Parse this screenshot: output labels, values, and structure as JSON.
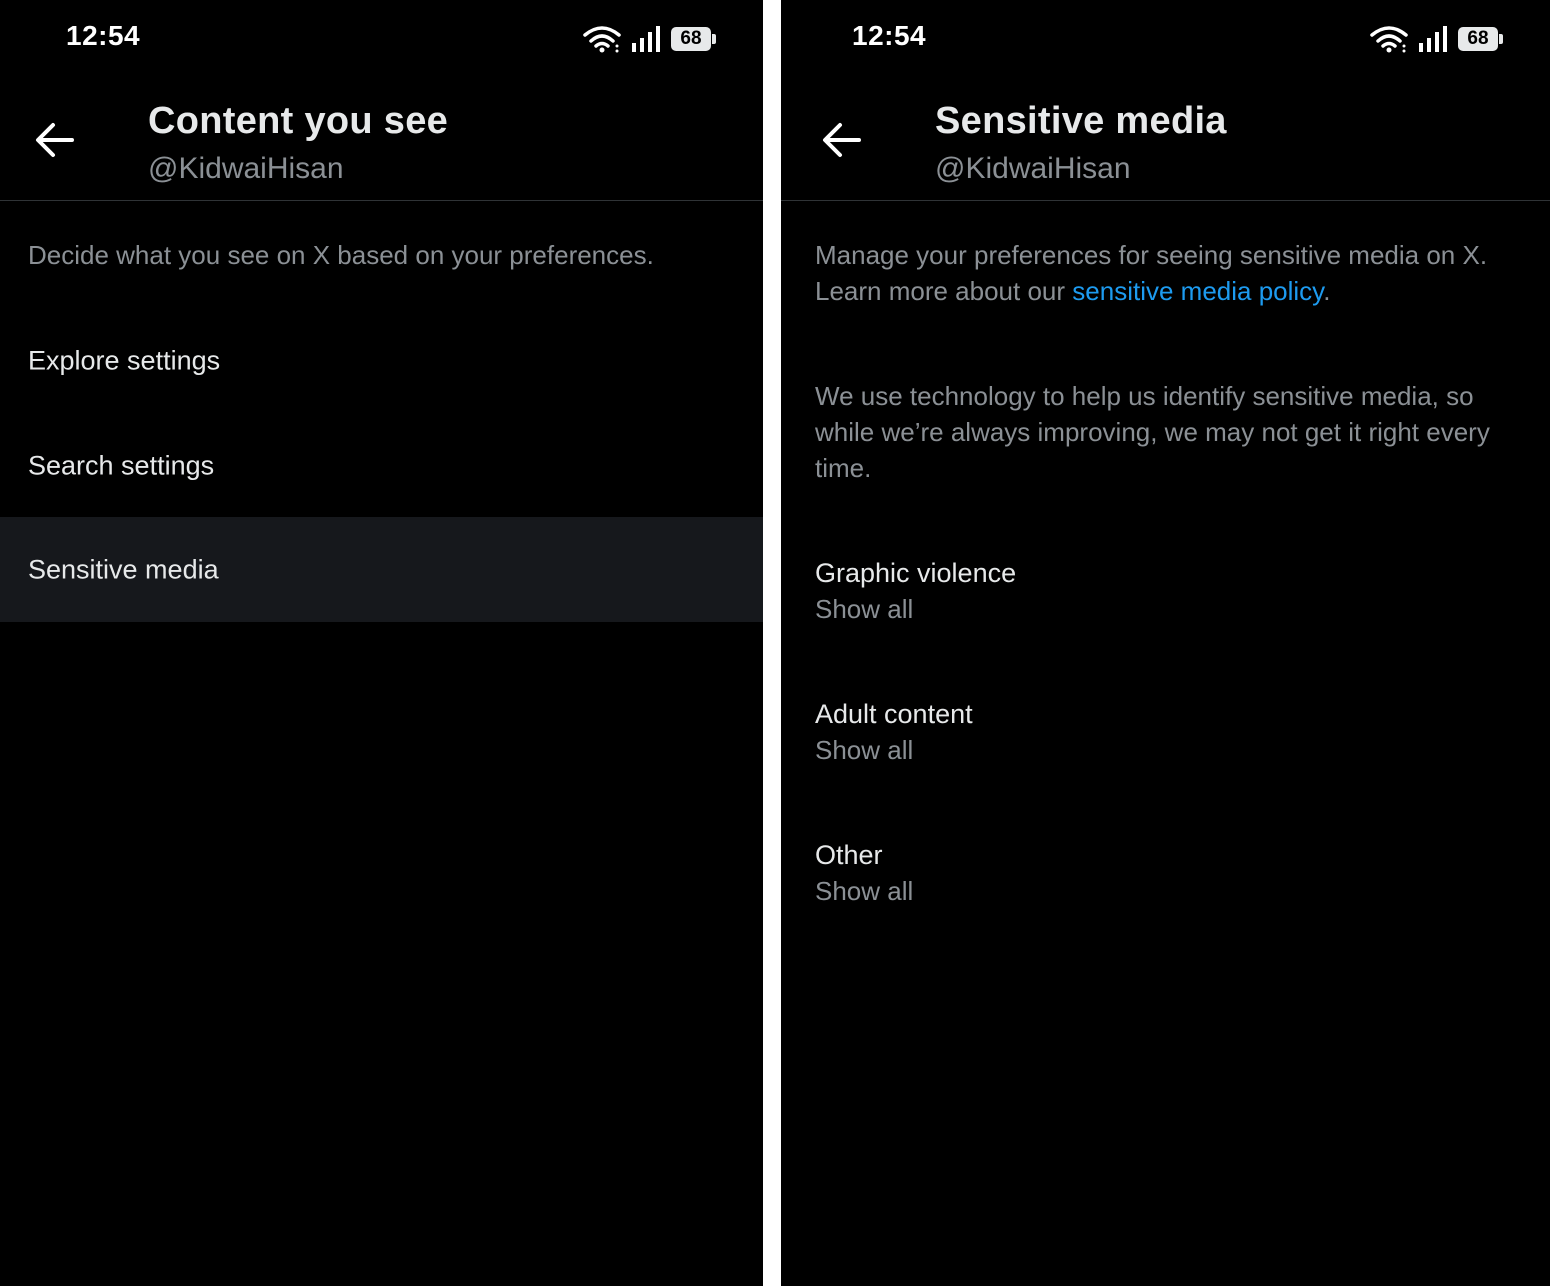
{
  "left_screen": {
    "status": {
      "time": "12:54",
      "battery": "68"
    },
    "header": {
      "title": "Content you see",
      "handle": "@KidwaiHisan"
    },
    "description": "Decide what you see on X based on your preferences.",
    "items": [
      {
        "label": "Explore settings"
      },
      {
        "label": "Search settings"
      },
      {
        "label": "Sensitive media"
      }
    ]
  },
  "right_screen": {
    "status": {
      "time": "12:54",
      "battery": "68"
    },
    "header": {
      "title": "Sensitive media",
      "handle": "@KidwaiHisan"
    },
    "description_prefix": "Manage your preferences for seeing sensitive media on X. Learn more about our ",
    "description_link": "sensitive media policy",
    "description_suffix": ".",
    "description2": "We use technology to help us identify sensitive media, so while we’re always improving, we may not get it right every time.",
    "settings": [
      {
        "title": "Graphic violence",
        "value": "Show all"
      },
      {
        "title": "Adult content",
        "value": "Show all"
      },
      {
        "title": "Other",
        "value": "Show all"
      }
    ]
  },
  "colors": {
    "background": "#000000",
    "primary_text": "#e7e9ea",
    "secondary_text": "#8b9095",
    "link": "#1d9bf0",
    "selected_row": "#16181c",
    "divider": "#2f3336"
  }
}
